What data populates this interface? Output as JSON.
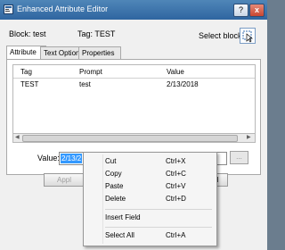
{
  "window": {
    "title": "Enhanced Attribute Editor",
    "help_label": "?",
    "close_label": "x"
  },
  "header": {
    "block_label": "Block: test",
    "tag_label": "Tag: TEST",
    "select_block_label": "Select block"
  },
  "tabs": [
    {
      "label": "Attribute",
      "active": true
    },
    {
      "label": "Text Options",
      "active": false
    },
    {
      "label": "Properties",
      "active": false
    }
  ],
  "grid": {
    "columns": [
      "Tag",
      "Prompt",
      "Value"
    ],
    "rows": [
      {
        "tag": "TEST",
        "prompt": "test",
        "value": "2/13/2018"
      }
    ]
  },
  "value_field": {
    "label": "Value:",
    "selected_text": "2/13/2",
    "ellipsis_label": "..."
  },
  "buttons": {
    "apply_label": "Appl",
    "cancel_label": "Cancel"
  },
  "context_menu": {
    "items": [
      {
        "label": "Cut",
        "shortcut": "Ctrl+X"
      },
      {
        "label": "Copy",
        "shortcut": "Ctrl+C"
      },
      {
        "label": "Paste",
        "shortcut": "Ctrl+V"
      },
      {
        "label": "Delete",
        "shortcut": "Ctrl+D"
      },
      {
        "label": "Insert Field",
        "shortcut": ""
      },
      {
        "label": "Select All",
        "shortcut": "Ctrl+A"
      }
    ]
  },
  "colors": {
    "titlebar": "#2f65a0",
    "selection": "#3399ff",
    "close_button": "#c74631"
  }
}
